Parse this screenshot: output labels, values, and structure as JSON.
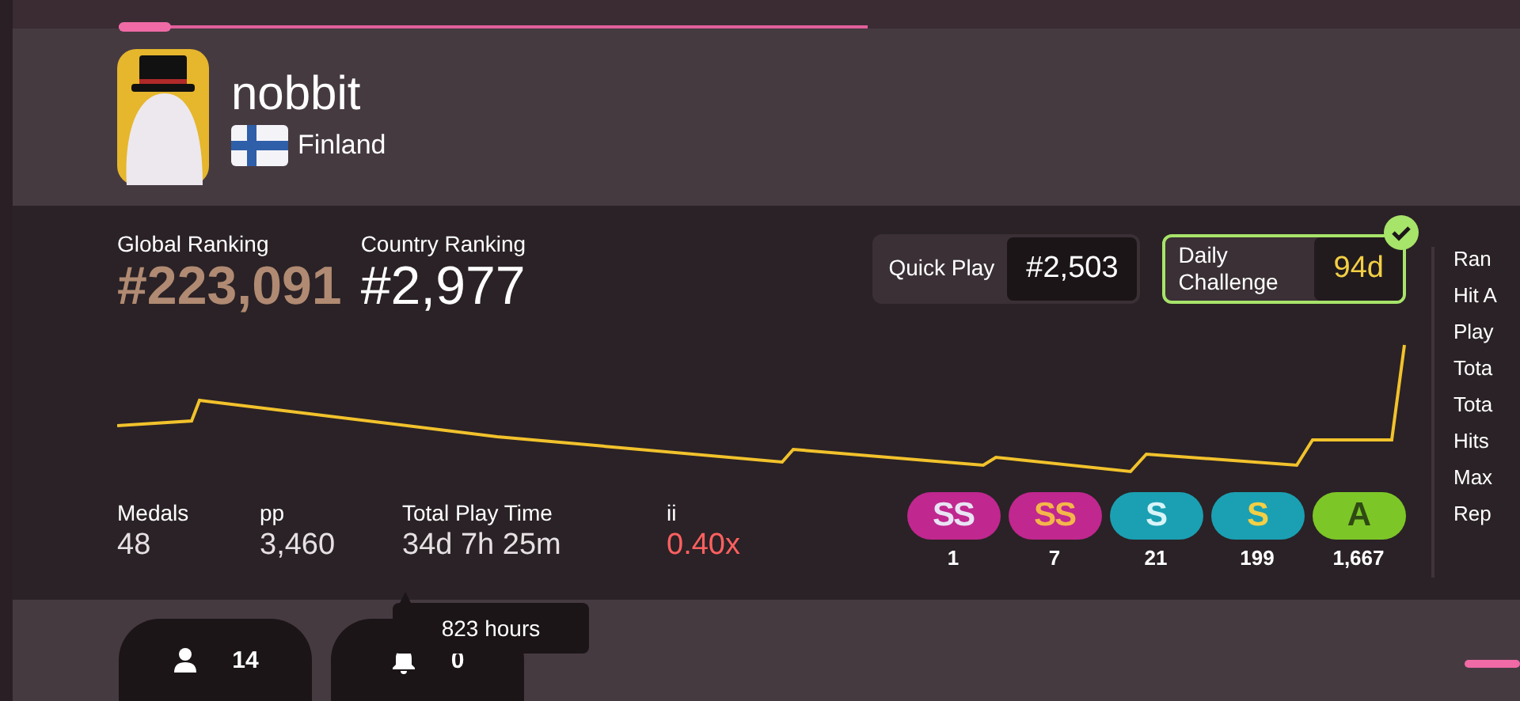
{
  "user": {
    "name": "nobbit",
    "country": "Finland"
  },
  "rankings": [
    {
      "label": "Global Ranking",
      "value": "#223,091",
      "kind": "global"
    },
    {
      "label": "Country Ranking",
      "value": "#2,977",
      "kind": "country"
    }
  ],
  "mode_ranks": [
    {
      "label": "Quick Play",
      "value": "#2,503",
      "checked": false
    },
    {
      "label": "Daily Challenge",
      "value": "94d",
      "checked": true
    }
  ],
  "stats": [
    {
      "label": "Medals",
      "value": "48",
      "kind": "plain"
    },
    {
      "label": "pp",
      "value": "3,460",
      "kind": "plain"
    },
    {
      "label": "Total Play Time",
      "value": "34d 7h 25m",
      "kind": "plain"
    },
    {
      "label": "ii",
      "value": "0.40x",
      "kind": "warning"
    }
  ],
  "grades": [
    {
      "label": "SS",
      "count": "1",
      "kind": "ss-silver"
    },
    {
      "label": "SS",
      "count": "7",
      "kind": "ss-gold"
    },
    {
      "label": "S",
      "count": "21",
      "kind": "s-silver"
    },
    {
      "label": "S",
      "count": "199",
      "kind": "s-gold"
    },
    {
      "label": "A",
      "count": "1,667",
      "kind": "a"
    }
  ],
  "side_labels": [
    "Ran",
    "Hit A",
    "Play",
    "Tota",
    "Tota",
    "Hits",
    "Max",
    "Rep"
  ],
  "tooltip": "823 hours",
  "buttons": [
    {
      "kind": "friends",
      "count": "14"
    },
    {
      "kind": "notifications",
      "count": "0"
    }
  ]
}
